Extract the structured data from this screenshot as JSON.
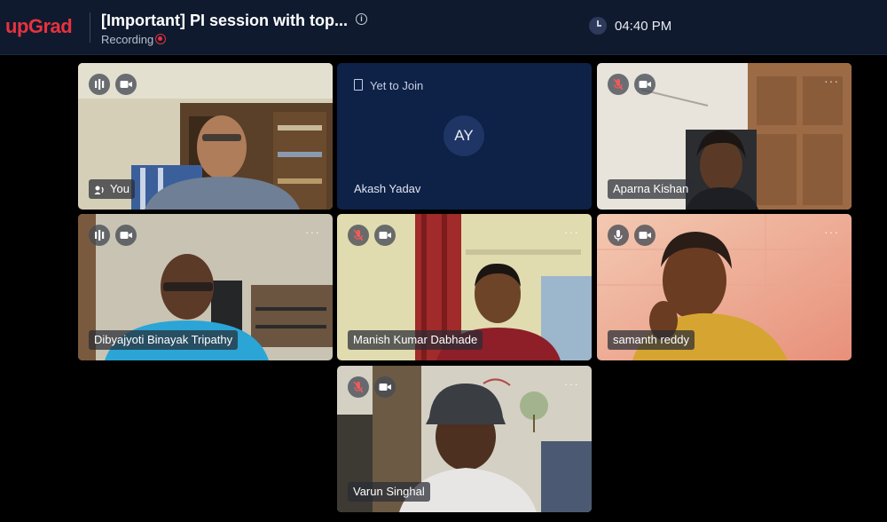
{
  "header": {
    "logo": "upGrad",
    "title": "[Important] PI session with top...",
    "info_icon": "info-icon",
    "recording_label": "Recording",
    "recording_icon": "record-dot-icon",
    "clock_icon": "clock-icon",
    "time": "04:40 PM"
  },
  "tiles": [
    {
      "name": "You",
      "audio_icon": "audio-level-icon",
      "video_icon": "camera-icon",
      "speaking_icon": "speaker-icon",
      "muted": false
    },
    {
      "status": "Yet to Join",
      "status_icon": "door-enter-icon",
      "initials": "AY",
      "name": "Akash Yadav"
    },
    {
      "name": "Aparna Kishan",
      "audio_icon": "mic-muted-icon",
      "video_icon": "camera-icon",
      "more": "···",
      "muted": true
    },
    {
      "name": "Dibyajyoti Binayak Tripathy",
      "audio_icon": "audio-level-icon",
      "video_icon": "camera-icon",
      "more": "···",
      "muted": false
    },
    {
      "name": "Manish Kumar Dabhade",
      "audio_icon": "mic-muted-icon",
      "video_icon": "camera-icon",
      "more": "···",
      "muted": true
    },
    {
      "name": "samanth reddy",
      "audio_icon": "mic-icon",
      "video_icon": "camera-icon",
      "more": "···",
      "muted": false
    },
    {
      "name": "Varun Singhal",
      "audio_icon": "mic-muted-icon",
      "video_icon": "camera-icon",
      "more": "···",
      "muted": true
    }
  ],
  "colors": {
    "brand": "#e7323f",
    "header_bg": "#0f1a2e",
    "tile_empty_bg": "#0e2248",
    "stage_bg": "#000000"
  }
}
